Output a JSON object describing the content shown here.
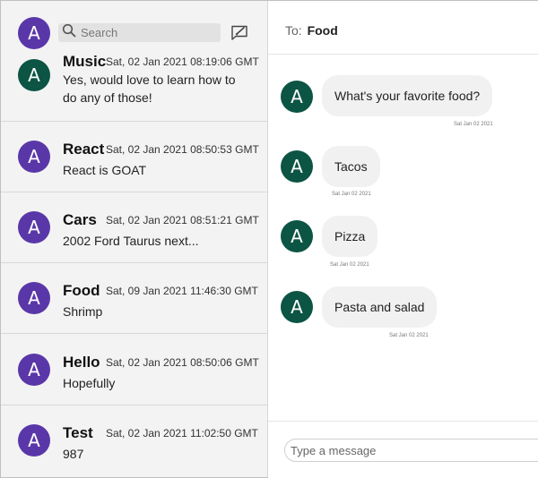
{
  "sidebar": {
    "user_avatar_letter": "A",
    "search": {
      "placeholder": "Search"
    },
    "conversations": [
      {
        "name": "Music",
        "time": "Sat, 02 Jan 2021 08:19:06 GMT",
        "preview_line1": "Yes, would love to learn how to",
        "preview_line2": "do any of those!"
      },
      {
        "name": "React",
        "time": "Sat, 02 Jan 2021 08:50:53 GMT",
        "preview": "React is GOAT"
      },
      {
        "name": "Cars",
        "time": "Sat, 02 Jan 2021 08:51:21 GMT",
        "preview": "2002 Ford Taurus next..."
      },
      {
        "name": "Food",
        "time": "Sat, 09 Jan 2021 11:46:30 GMT",
        "preview": "Shrimp"
      },
      {
        "name": "Hello",
        "time": "Sat, 02 Jan 2021 08:50:06 GMT",
        "preview": "Hopefully"
      },
      {
        "name": "Test",
        "time": "Sat, 02 Jan 2021 11:02:50 GMT",
        "preview": "987"
      }
    ],
    "avatar_letter": "A"
  },
  "chat": {
    "to_label": "To:",
    "to_name": "Food",
    "messages": [
      {
        "text": "What's your favorite food?",
        "date": "Sat Jan 02 2021"
      },
      {
        "text": "Tacos",
        "date": "Sat Jan 02 2021"
      },
      {
        "text": "Pizza",
        "date": "Sat Jan 02 2021"
      },
      {
        "text": "Pasta and salad",
        "date": "Sat Jan 02 2021"
      }
    ],
    "avatar_letter": "A",
    "composer": {
      "placeholder": "Type a message"
    }
  },
  "colors": {
    "sidebar_avatar": "#5a37a8",
    "chat_avatar": "#0c5443",
    "sidebar_bg": "#f3f3f3",
    "bubble_bg": "#f1f1f1"
  },
  "icons": {
    "search": "search-icon",
    "compose": "compose-icon"
  }
}
